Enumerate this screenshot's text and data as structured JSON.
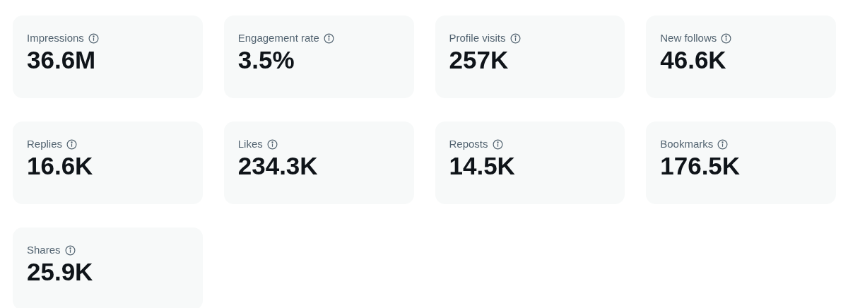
{
  "metrics": [
    {
      "label": "Impressions",
      "value": "36.6M"
    },
    {
      "label": "Engagement rate",
      "value": "3.5%"
    },
    {
      "label": "Profile visits",
      "value": "257K"
    },
    {
      "label": "New follows",
      "value": "46.6K"
    },
    {
      "label": "Replies",
      "value": "16.6K"
    },
    {
      "label": "Likes",
      "value": "234.3K"
    },
    {
      "label": "Reposts",
      "value": "14.5K"
    },
    {
      "label": "Bookmarks",
      "value": "176.5K"
    },
    {
      "label": "Shares",
      "value": "25.9K"
    }
  ]
}
